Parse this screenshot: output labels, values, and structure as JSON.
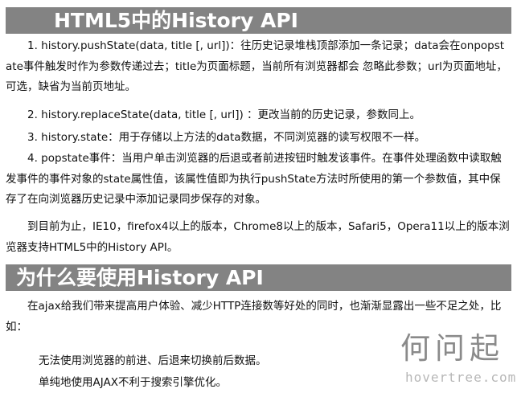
{
  "header": {
    "title": "HTML5中的History API"
  },
  "methods": [
    "1. history.pushState(data, title [, url])：往历史记录堆栈顶部添加一条记录；data会在onpopstate事件触发时作为参数传递过去；title为页面标题，当前所有浏览器都会 忽略此参数；url为页面地址，可选，缺省为当前页地址。",
    "2. history.replaceState(data, title [, url]) ：更改当前的历史记录，参数同上。",
    "3. history.state：用于存储以上方法的data数据，不同浏览器的读写权限不一样。",
    "4. popstate事件：当用户单击浏览器的后退或者前进按钮时触发该事件。在事件处理函数中读取触发事件的事件对象的state属性值，该属性值即为执行pushState方法时所使用的第一个参数值，其中保存了在向浏览器历史记录中添加记录同步保存的对象。",
    "到目前为止，IE10，firefox4以上的版本，Chrome8以上的版本，Safari5，Opera11以上的版本浏览器支持HTML5中的History API。"
  ],
  "section2": {
    "title": "为什么要使用History API",
    "intro": "在ajax给我们带来提高用户体验、减少HTTP连接数等好处的同时，也渐渐显露出一些不足之处，比如：",
    "items": [
      "无法使用浏览器的前进、后退来切换前后数据。",
      "单纯地使用AJAX不利于搜索引擎优化。"
    ]
  },
  "watermark": {
    "chinese": "何问起",
    "domain": "hovertree.com"
  }
}
